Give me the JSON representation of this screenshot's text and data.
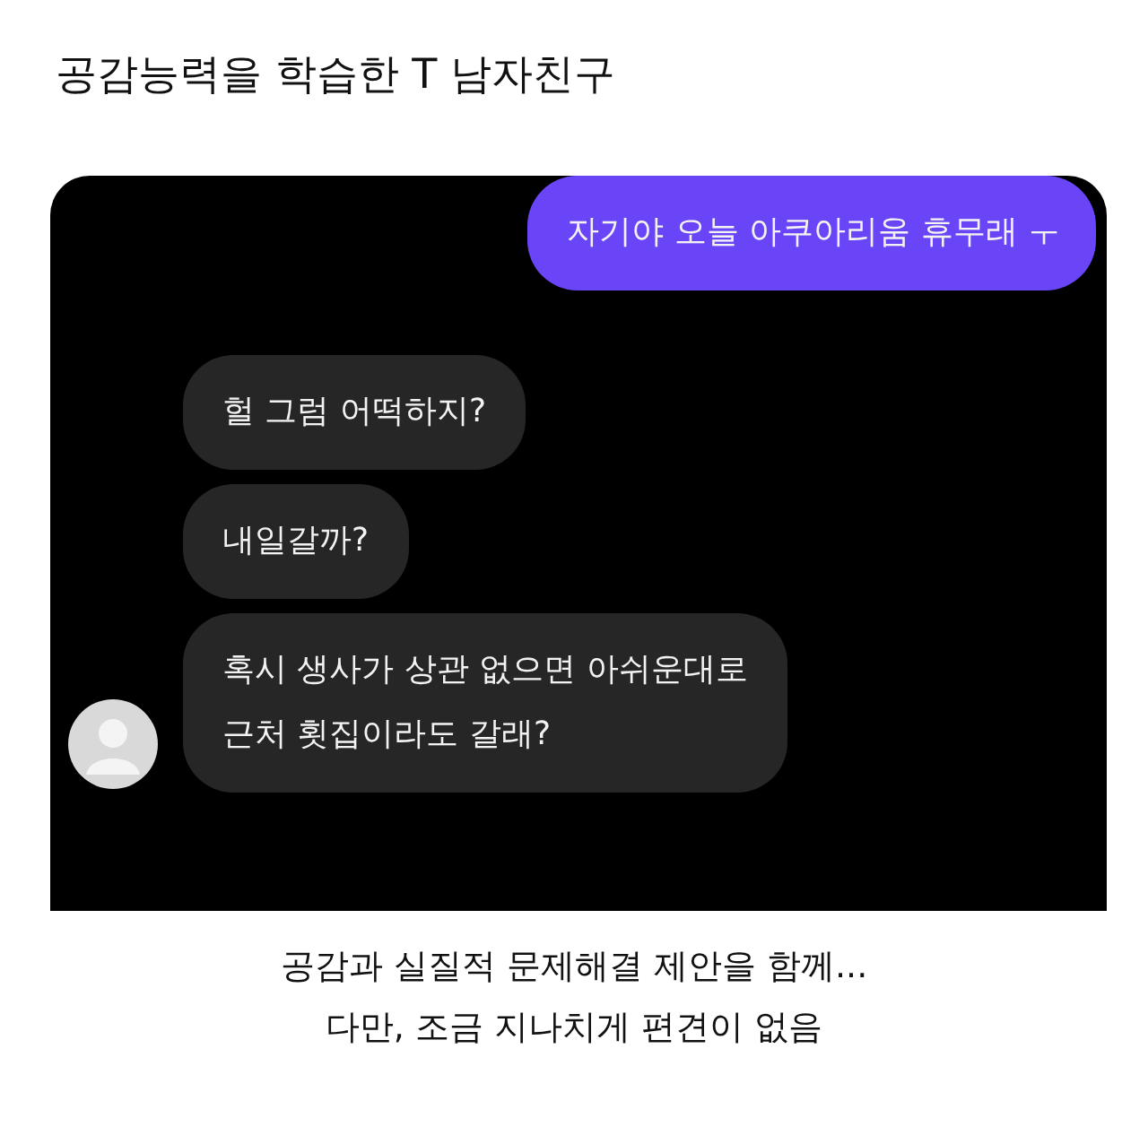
{
  "title": "공감능력을 학습한 T 남자친구",
  "chat": {
    "messages": [
      {
        "kind": "sent",
        "text": "자기야 오늘 아쿠아리움 휴무래 ㅜ",
        "avatar": false
      },
      {
        "kind": "received",
        "text": "헐 그럼 어떡하지?",
        "avatar": false
      },
      {
        "kind": "received",
        "text": "내일갈까?",
        "avatar": false
      },
      {
        "kind": "received",
        "text": "혹시 생사가 상관 없으면 아쉬운대로\n근처 횟집이라도 갈래?",
        "avatar": true
      }
    ]
  },
  "caption": [
    "공감과 실질적 문제해결 제안을 함께...",
    "다만, 조금 지나치게 편견이 없음"
  ]
}
